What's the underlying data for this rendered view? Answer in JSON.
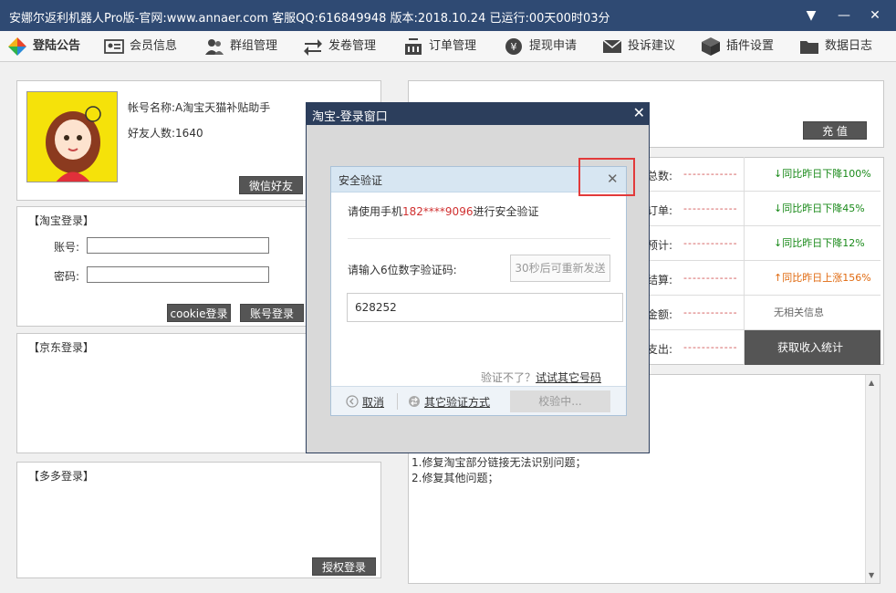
{
  "titlebar": {
    "title": "安娜尔返利机器人Pro版-官网:www.annaer.com 客服QQ:616849948  版本:2018.10.24     已运行:00天00时03分",
    "menu_glyph": "▼",
    "min_glyph": "—",
    "close_glyph": "✕"
  },
  "nav": {
    "items": [
      {
        "label": "登陆公告",
        "icon": "colorful-logo-icon"
      },
      {
        "label": "会员信息",
        "icon": "id-card-icon"
      },
      {
        "label": "群组管理",
        "icon": "users-icon"
      },
      {
        "label": "发卷管理",
        "icon": "transfer-arrows-icon"
      },
      {
        "label": "订单管理",
        "icon": "basket-icon"
      },
      {
        "label": "提现申请",
        "icon": "yen-coin-icon"
      },
      {
        "label": "投诉建议",
        "icon": "envelope-icon"
      },
      {
        "label": "插件设置",
        "icon": "cube-icon"
      },
      {
        "label": "数据日志",
        "icon": "folder-icon"
      }
    ]
  },
  "account": {
    "name_text": "帐号名称:A淘宝天猫补贴助手",
    "friends_text": "好友人数:1640",
    "wechat_button": "微信好友"
  },
  "taobao_login": {
    "title": "【淘宝登录】",
    "account_label": "账号:",
    "password_label": "密码:",
    "cookie_button": "cookie登录",
    "account_button": "账号登录"
  },
  "jd_login": {
    "title": "【京东登录】"
  },
  "pdd_login": {
    "title": "【多多登录】",
    "auth_button": "授权登录"
  },
  "right_top": {
    "recharge_button": "充  值"
  },
  "stats": {
    "dash": "------------",
    "rows": [
      {
        "label": "总数:",
        "compare": "↓同比昨日下降100%"
      },
      {
        "label": "订单:",
        "compare": "↓同比昨日下降45%"
      },
      {
        "label": "预计:",
        "compare": "↓同比昨日下降12%"
      },
      {
        "label": "结算:",
        "compare": "↑同比昨日上涨156%"
      },
      {
        "label": "金额:",
        "compare": "无相关信息"
      },
      {
        "label": "支出:",
        "compare": "获取收入统计"
      }
    ]
  },
  "log": {
    "lines": [
      "1.修复淘宝部分链接无法识别问题；",
      "2.修复其他问题；"
    ]
  },
  "login_window": {
    "title": "淘宝-登录窗口",
    "close_glyph": "✕"
  },
  "security": {
    "title": "安全验证",
    "close_glyph": "✕",
    "phone_prefix": "请使用手机",
    "phone": "182****9096",
    "phone_suffix": "进行安全验证",
    "code_label": "请输入6位数字验证码:",
    "resend_button": "30秒后可重新发送",
    "code_value": "628252",
    "help_prefix": "验证不了？",
    "help_link": "试试其它号码",
    "cancel": "取消",
    "other_method": "其它验证方式",
    "verify_button": "校验中..."
  },
  "colors": {
    "titlebar": "#2f4a73",
    "accent_red": "#e23a3a",
    "green": "#1a8a1a",
    "orange": "#e06a10"
  }
}
